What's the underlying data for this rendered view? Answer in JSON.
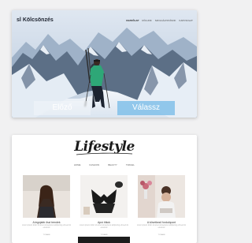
{
  "card1": {
    "logo_mark": "sl",
    "logo_text": "Kölcsönzés",
    "nav": [
      "KEZDŐLAP",
      "RÓLUNK",
      "SZOLGÁLTATÁSOK",
      "KAPCSOLAT"
    ],
    "prev_button": "Előző",
    "next_button": "Válassz"
  },
  "card2": {
    "title": "Lifestyle",
    "nav": [
      "HOME",
      "FASHION",
      "BEAUTY",
      "TRAVEL"
    ],
    "posts": [
      {
        "caption": "A legújabb őszi trendek",
        "excerpt": "Lorem ipsum dolor sit amet consectetur adipiscing elit sed do eiusmod",
        "more": "TOVÁBB"
      },
      {
        "caption": "Apró titkok",
        "excerpt": "Lorem ipsum dolor sit amet consectetur adipiscing elit sed do eiusmod",
        "more": "TOVÁBB"
      },
      {
        "caption": "A következő fordulópont",
        "excerpt": "Lorem ipsum dolor sit amet consectetur adipiscing elit sed do eiusmod",
        "more": "TOVÁBB"
      }
    ]
  }
}
